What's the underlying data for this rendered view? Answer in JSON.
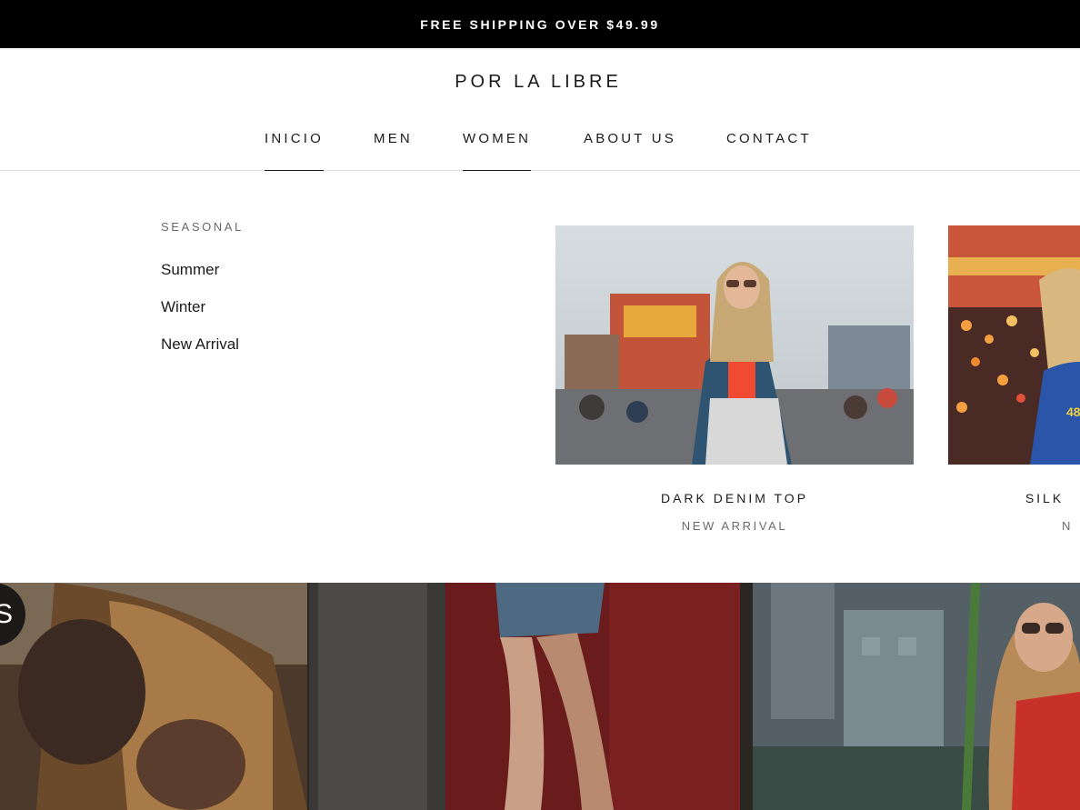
{
  "announcement": {
    "text": "FREE SHIPPING OVER $49.99"
  },
  "header": {
    "logo": "POR LA LIBRE"
  },
  "nav": {
    "items": [
      {
        "label": "INICIO",
        "active": true
      },
      {
        "label": "MEN",
        "active": false
      },
      {
        "label": "WOMEN",
        "active": true
      },
      {
        "label": "ABOUT US",
        "active": false
      },
      {
        "label": "CONTACT",
        "active": false
      }
    ]
  },
  "mega_menu": {
    "column_title": "SEASONAL",
    "links": [
      "Summer",
      "Winter",
      "New Arrival"
    ],
    "promos": [
      {
        "title": "DARK DENIM TOP",
        "subtitle": "NEW ARRIVAL"
      },
      {
        "title": "SILK",
        "subtitle": "N"
      }
    ]
  },
  "gallery": {
    "badge_text": "S"
  },
  "colors": {
    "announcement_bg": "#000000",
    "text": "#1c1b1b",
    "muted": "#6a6a6a",
    "divider": "#dedede"
  }
}
